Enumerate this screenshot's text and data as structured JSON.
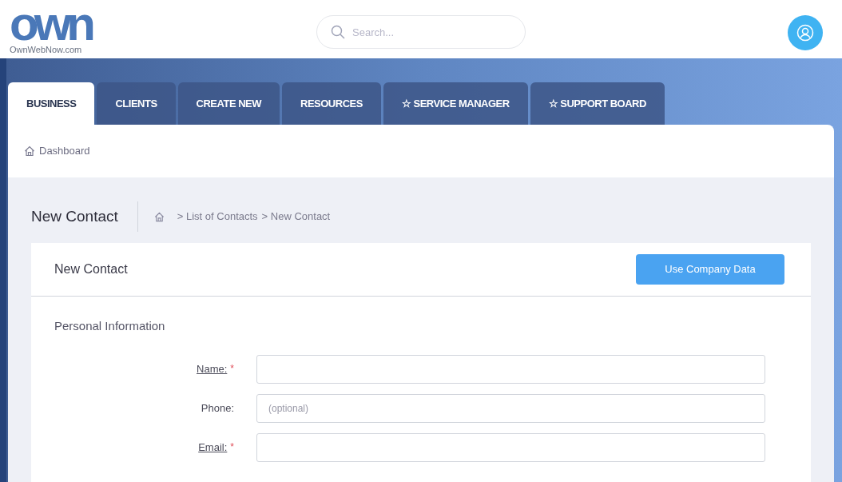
{
  "logo": {
    "mark": "own",
    "site": "OwnWebNow.com"
  },
  "search": {
    "placeholder": "Search..."
  },
  "tabs": [
    {
      "label": "BUSINESS",
      "selected": true
    },
    {
      "label": "CLIENTS",
      "selected": false
    },
    {
      "label": "CREATE NEW",
      "selected": false
    },
    {
      "label": "RESOURCES",
      "selected": false
    },
    {
      "label": "☆ SERVICE MANAGER",
      "selected": false
    },
    {
      "label": "☆ SUPPORT BOARD",
      "selected": false
    }
  ],
  "subnav": {
    "label": "Dashboard"
  },
  "page": {
    "title": "New Contact",
    "breadcrumbs": [
      "> List of Contacts",
      "> New Contact"
    ]
  },
  "card": {
    "title": "New Contact",
    "button": "Use Company Data",
    "section": "Personal Information",
    "fields": [
      {
        "label": "Name:",
        "underlined": true,
        "required_mark": "*"
      },
      {
        "label": "Phone:",
        "underlined": false,
        "placeholder": "(optional)"
      },
      {
        "label": "Email:",
        "underlined": true,
        "required_mark": "*"
      }
    ]
  }
}
